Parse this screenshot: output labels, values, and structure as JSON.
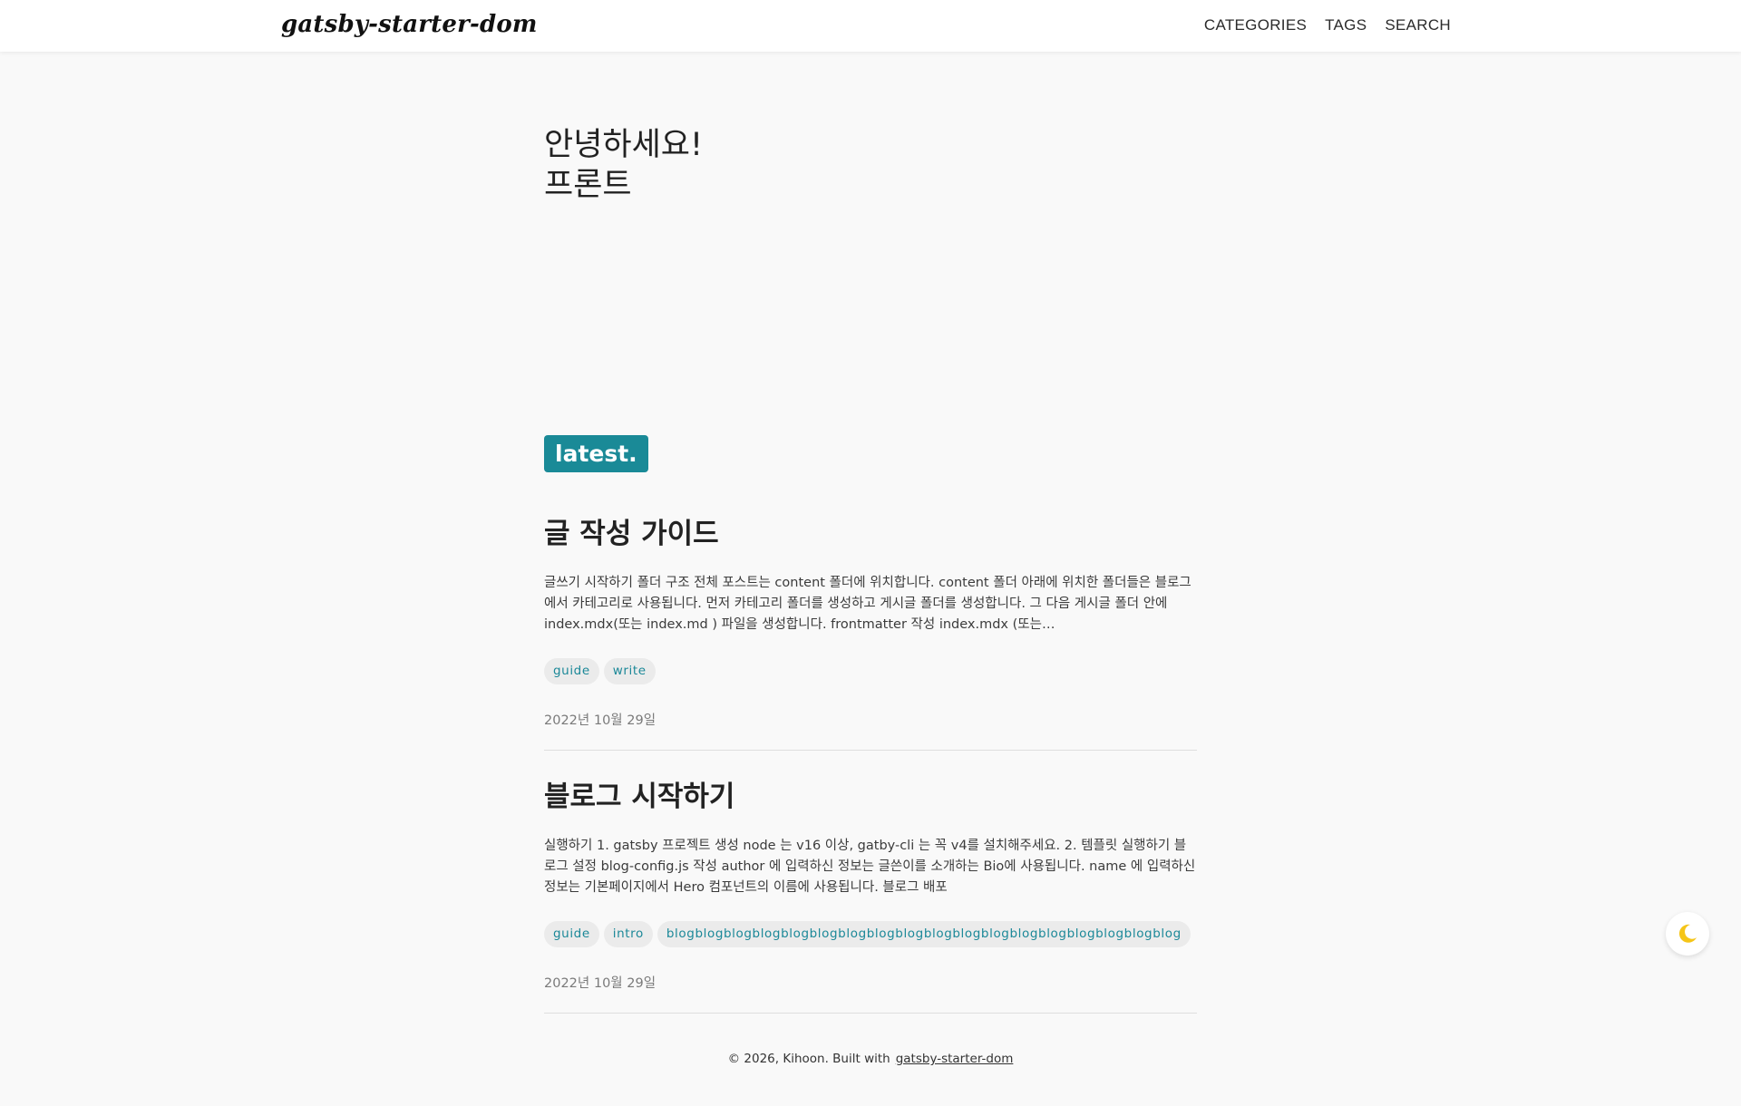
{
  "header": {
    "brand": "gatsby-starter-dom",
    "nav": [
      "CATEGORIES",
      "TAGS",
      "SEARCH"
    ]
  },
  "hero": {
    "line1": "안녕하세요!",
    "line2": "프론트"
  },
  "latest_badge": "latest.",
  "posts": [
    {
      "title": "글 작성 가이드",
      "excerpt": "글쓰기 시작하기 폴더 구조 전체 포스트는 content 폴더에 위치합니다. content 폴더 아래에 위치한 폴더들은 블로그에서 카테고리로 사용됩니다. 먼저 카테고리 폴더를 생성하고 게시글 폴더를 생성합니다. 그 다음 게시글 폴더 안에 index.mdx(또는 index.md ) 파일을 생성합니다. frontmatter 작성 index.mdx (또는…",
      "tags": [
        "guide",
        "write"
      ],
      "date": "2022년 10월 29일"
    },
    {
      "title": "블로그 시작하기",
      "excerpt": "실행하기 1. gatsby 프로젝트 생성 node 는 v16 이상, gatby-cli 는 꼭 v4를 설치해주세요. 2. 템플릿 실행하기 블로그 설정 blog-config.js 작성 author 에 입력하신 정보는 글쓴이를 소개하는 Bio에 사용됩니다. name 에 입력하신 정보는 기본페이지에서 Hero 컴포넌트의 이름에 사용됩니다. 블로그 배포",
      "tags": [
        "guide",
        "intro",
        "blogblogblogblogblogblogblogblogblogblogblogblogblogblogblogblogblogblog"
      ],
      "date": "2022년 10월 29일"
    }
  ],
  "footer": {
    "text": "© 2026, Kihoon. Built with",
    "link": "gatsby-starter-dom"
  },
  "theme_toggle": {
    "icon": "moon-icon",
    "color": "#f5c518"
  }
}
